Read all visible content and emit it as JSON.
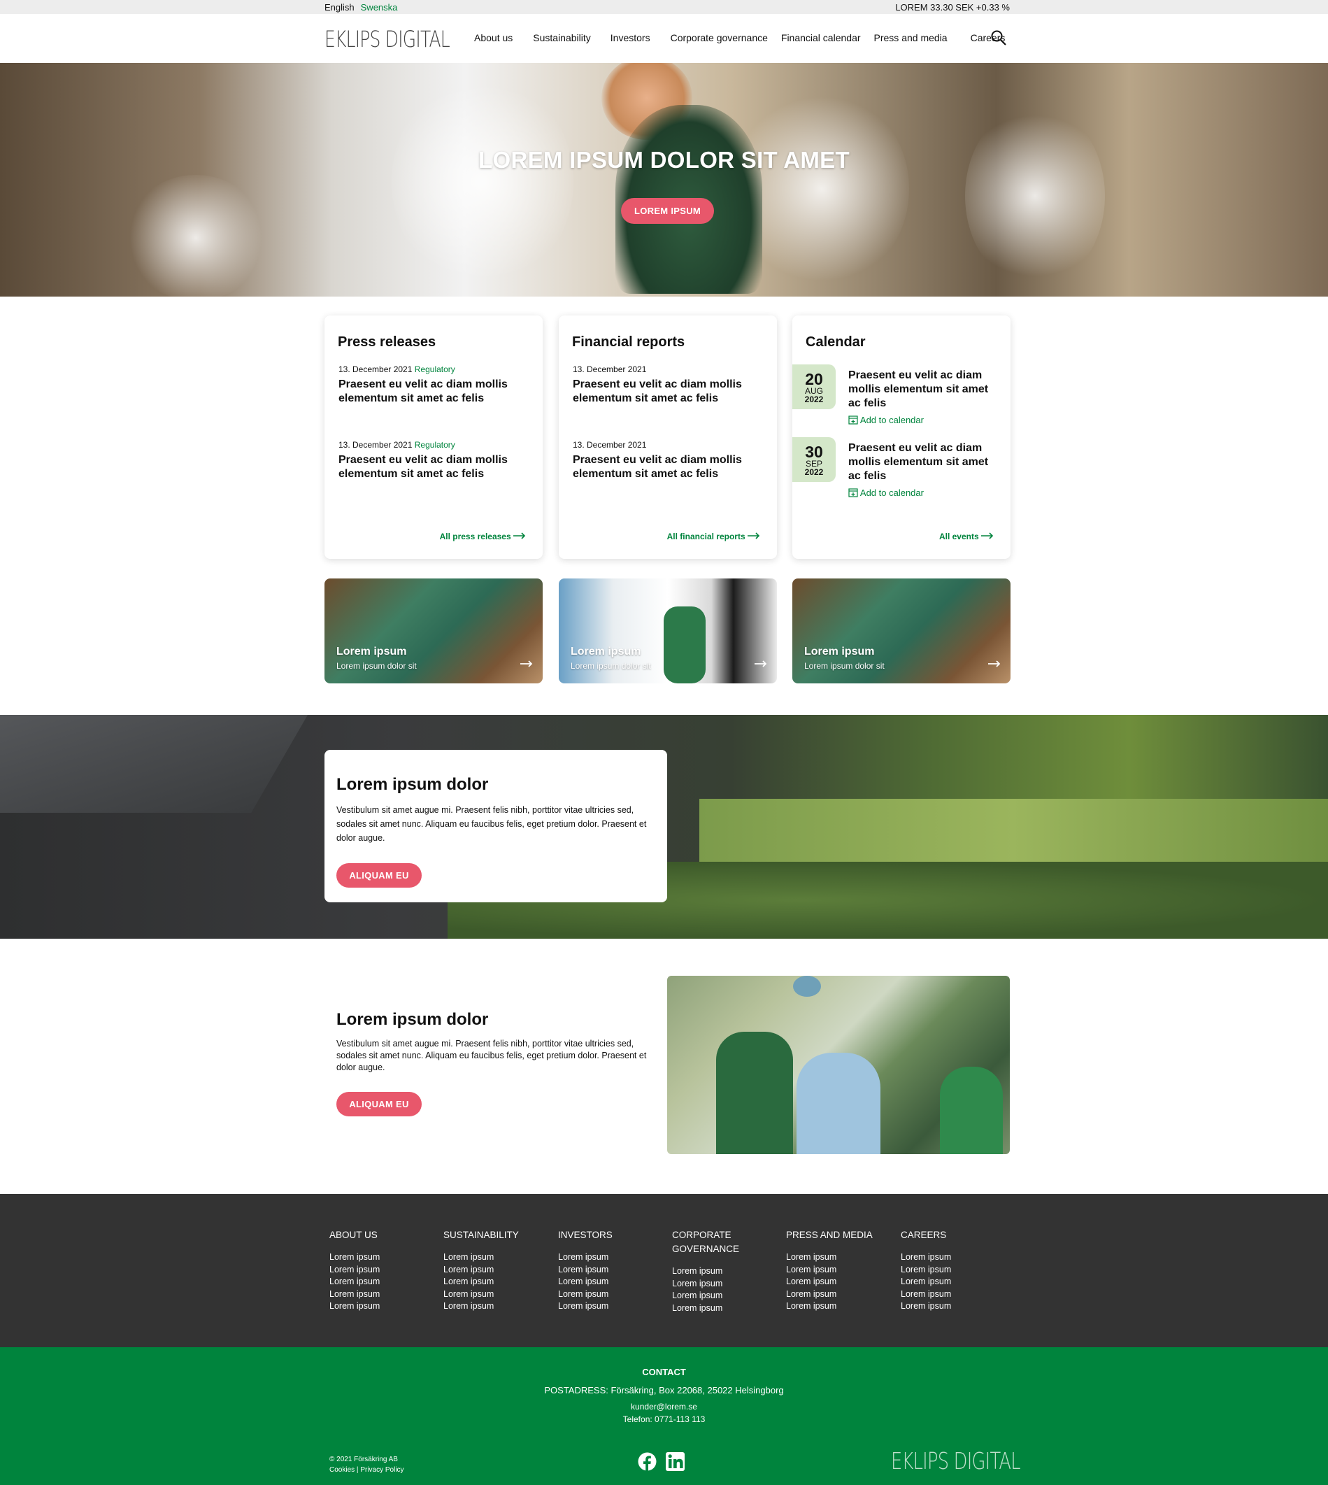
{
  "topbar": {
    "lang_en": "English",
    "lang_sv": "Swenska",
    "stock": "LOREM 33.30 SEK +0.33 %"
  },
  "header": {
    "logo": "EKLIPS DIGITAL",
    "nav": [
      "About us",
      "Sustainability",
      "Investors",
      "Corporate governance",
      "Financial calendar",
      "Press and media",
      "Careers"
    ]
  },
  "hero": {
    "title": "LOREM IPSUM DOLOR SIT AMET",
    "button": "LOREM IPSUM"
  },
  "press": {
    "title": "Press releases",
    "items": [
      {
        "date": "13. December 2021",
        "tag": "Regulatory",
        "title": "Praesent eu velit ac diam mollis elementum sit amet ac felis"
      },
      {
        "date": "13. December 2021",
        "tag": "Regulatory",
        "title": "Praesent eu velit ac diam mollis elementum sit amet ac felis"
      }
    ],
    "more": "All press releases"
  },
  "reports": {
    "title": "Financial reports",
    "items": [
      {
        "date": "13. December 2021",
        "title": "Praesent eu velit ac diam mollis elementum sit amet ac felis"
      },
      {
        "date": "13. December 2021",
        "title": "Praesent eu velit ac diam mollis elementum sit amet ac felis"
      }
    ],
    "more": "All financial reports"
  },
  "calendar": {
    "title": "Calendar",
    "items": [
      {
        "day": "20",
        "month": "AUG",
        "year": "2022",
        "title": "Praesent eu velit ac diam mollis elementum sit amet ac felis",
        "add": "Add to calendar"
      },
      {
        "day": "30",
        "month": "SEP",
        "year": "2022",
        "title": "Praesent eu velit ac diam mollis elementum sit amet ac felis",
        "add": "Add to calendar"
      }
    ],
    "more": "All events"
  },
  "tiles": [
    {
      "title": "Lorem ipsum",
      "sub": "Lorem ipsum dolor sit"
    },
    {
      "title": "Lorem ipsum",
      "sub": "Lorem ipsum dolor sit"
    },
    {
      "title": "Lorem ipsum",
      "sub": "Lorem ipsum dolor sit"
    }
  ],
  "band": {
    "title": "Lorem ipsum dolor",
    "text": "Vestibulum sit amet augue mi. Praesent felis nibh, porttitor vitae ultricies sed, sodales sit amet nunc. Aliquam eu faucibus felis, eget pretium dolor. Praesent et dolor augue.",
    "button": "ALIQUAM EU"
  },
  "section2": {
    "title": "Lorem ipsum dolor",
    "text": "Vestibulum sit amet augue mi. Praesent felis nibh, porttitor vitae ultricies sed, sodales sit amet nunc. Aliquam eu faucibus felis, eget pretium dolor. Praesent et dolor augue.",
    "button": "ALIQUAM EU"
  },
  "footer": {
    "columns": [
      {
        "title": "ABOUT US",
        "links": [
          "Lorem ipsum",
          "Lorem ipsum",
          "Lorem ipsum",
          "Lorem ipsum",
          "Lorem ipsum"
        ]
      },
      {
        "title": "SUSTAINABILITY",
        "links": [
          "Lorem ipsum",
          "Lorem ipsum",
          "Lorem ipsum",
          "Lorem ipsum",
          "Lorem ipsum"
        ]
      },
      {
        "title": "INVESTORS",
        "links": [
          "Lorem ipsum",
          "Lorem ipsum",
          "Lorem ipsum",
          "Lorem ipsum",
          "Lorem ipsum"
        ]
      },
      {
        "title": "CORPORATE GOVERNANCE",
        "links": [
          "Lorem ipsum",
          "Lorem ipsum",
          "Lorem ipsum",
          "Lorem ipsum"
        ]
      },
      {
        "title": "PRESS AND MEDIA",
        "links": [
          "Lorem ipsum",
          "Lorem ipsum",
          "Lorem ipsum",
          "Lorem ipsum",
          "Lorem ipsum"
        ]
      },
      {
        "title": "CAREERS",
        "links": [
          "Lorem ipsum",
          "Lorem ipsum",
          "Lorem ipsum",
          "Lorem ipsum",
          "Lorem ipsum"
        ]
      }
    ]
  },
  "contact": {
    "title": "CONTACT",
    "address": "POSTADRESS: Försäkring, Box 22068, 25022 Helsingborg",
    "email": "kunder@lorem.se",
    "phone": "Telefon: 0771-113 113",
    "copyright": "© 2021 Försäkring AB",
    "cookies": "Cookies",
    "sep": "|",
    "privacy": "Privacy Policy",
    "logo": "EKLIPS DIGITAL"
  },
  "colors": {
    "accent": "#00843d",
    "button": "#e8576b",
    "footer": "#333333",
    "badge": "#d4e7c9"
  },
  "icons": {
    "search": "search-icon",
    "arrow": "arrow-right-icon",
    "calendar": "calendar-add-icon",
    "facebook": "facebook-icon",
    "linkedin": "linkedin-icon"
  }
}
